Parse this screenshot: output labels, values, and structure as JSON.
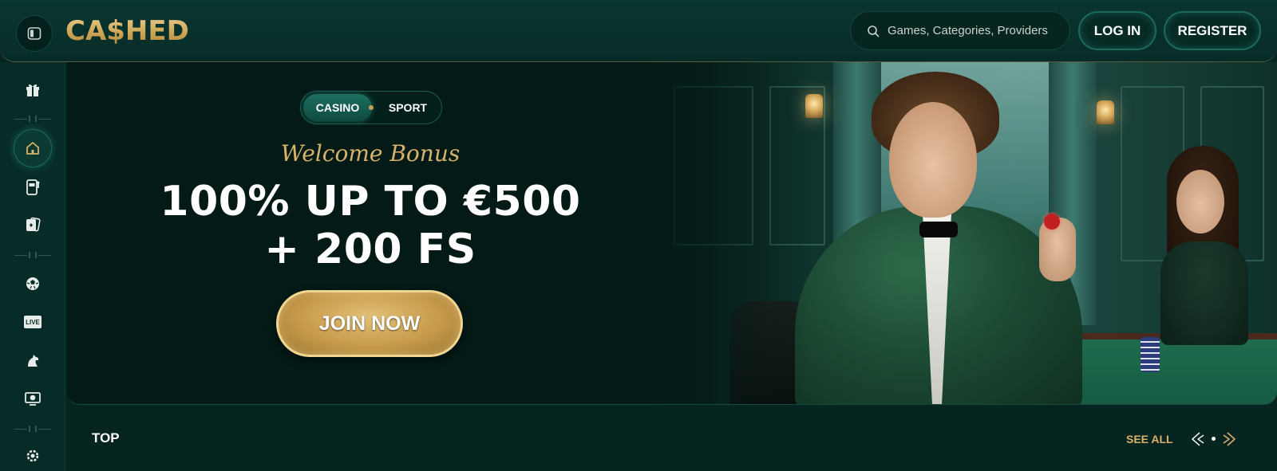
{
  "brand": {
    "logo_text": "CA$HED",
    "accent_color": "#d7b26a"
  },
  "header": {
    "search_placeholder": "Games, Categories, Providers",
    "login_label": "LOG IN",
    "register_label": "REGISTER"
  },
  "sidebar": {
    "items": [
      {
        "icon": "gift-icon"
      },
      {
        "icon": "home-icon",
        "active": true
      },
      {
        "icon": "slot-machine-icon"
      },
      {
        "icon": "cards-icon"
      },
      {
        "icon": "sports-ball-icon"
      },
      {
        "icon": "live-icon",
        "label": "LIVE"
      },
      {
        "icon": "horse-icon"
      },
      {
        "icon": "esports-icon"
      },
      {
        "icon": "settings-icon"
      }
    ]
  },
  "banner": {
    "switch": {
      "casino_label": "CASINO",
      "sport_label": "SPORT",
      "selected": "CASINO"
    },
    "welcome_label": "Welcome Bonus",
    "headline_line1": "100% UP TO €500",
    "headline_line2": "+ 200 FS",
    "cta_label": "JOIN NOW"
  },
  "top_section": {
    "title": "TOP",
    "see_all_label": "SEE ALL"
  }
}
